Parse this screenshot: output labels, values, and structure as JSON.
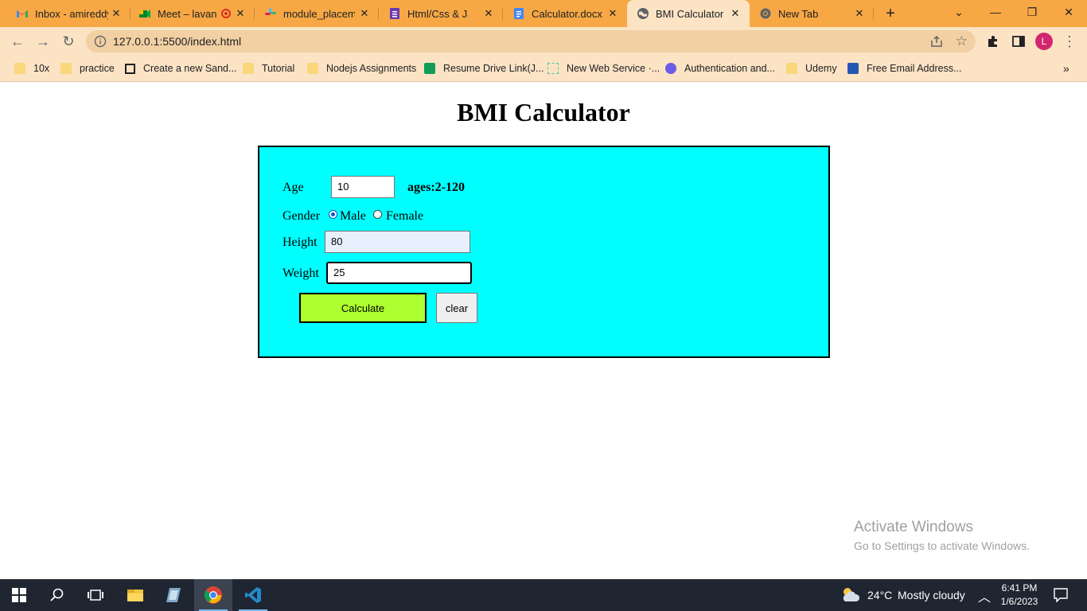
{
  "browser": {
    "tabs": [
      {
        "label": "Inbox - amireddy",
        "icon": "gmail-icon"
      },
      {
        "label": "Meet – lavan",
        "icon": "meet-icon"
      },
      {
        "label": "module_placeme",
        "icon": "slack-icon"
      },
      {
        "label": "Html/Css & JavaS",
        "icon": "forms-icon"
      },
      {
        "label": "Calculator.docx -",
        "icon": "docs-icon"
      },
      {
        "label": "BMI Calculator",
        "icon": "globe-icon",
        "active": true
      },
      {
        "label": "New Tab",
        "icon": "chrome-icon"
      }
    ],
    "url": "127.0.0.1:5500/index.html",
    "profile_initial": "L",
    "bookmarks": [
      {
        "label": "10x",
        "icon": "folder-icon"
      },
      {
        "label": "practice",
        "icon": "folder-icon"
      },
      {
        "label": "Create a new Sand...",
        "icon": "codesandbox-icon"
      },
      {
        "label": "Tutorial",
        "icon": "folder-icon"
      },
      {
        "label": "Nodejs Assignments",
        "icon": "folder-icon"
      },
      {
        "label": "Resume Drive Link(J...",
        "icon": "sheets-icon"
      },
      {
        "label": "New Web Service ·...",
        "icon": "render-icon"
      },
      {
        "label": "Authentication and...",
        "icon": "auth-icon"
      },
      {
        "label": "Udemy",
        "icon": "folder-icon"
      },
      {
        "label": "Free Email Address...",
        "icon": "mailinator-icon"
      }
    ]
  },
  "page": {
    "title": "BMI Calculator",
    "form": {
      "age_label": "Age",
      "age_value": "10",
      "age_hint": "ages:2-120",
      "gender_label": "Gender",
      "gender_male": "Male",
      "gender_female": "Female",
      "gender_selected": "Male",
      "height_label": "Height",
      "height_value": "80",
      "weight_label": "Weight",
      "weight_value": "25",
      "calculate_label": "Calculate",
      "clear_label": "clear"
    },
    "panel_color": "#00ffff",
    "calculate_color": "#adff2f"
  },
  "watermark": {
    "line1": "Activate Windows",
    "line2": "Go to Settings to activate Windows."
  },
  "taskbar": {
    "weather_temp": "24°C",
    "weather_text": "Mostly cloudy",
    "time": "6:41 PM",
    "date": "1/6/2023"
  }
}
